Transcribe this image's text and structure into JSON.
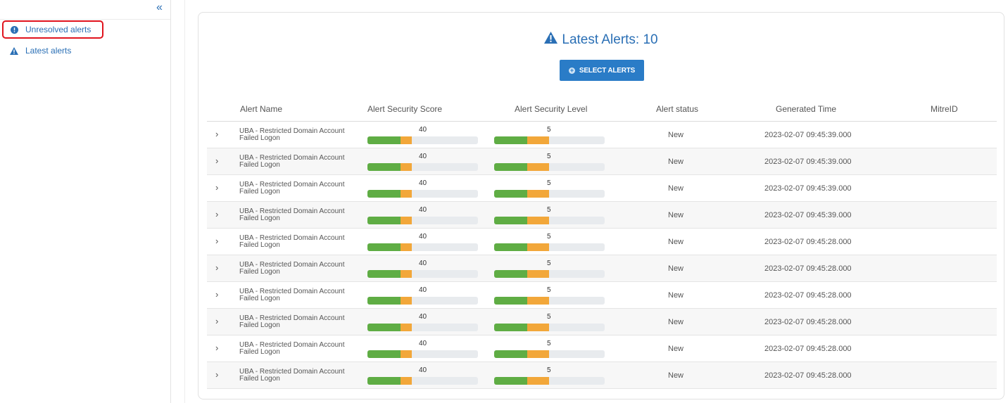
{
  "sidebar": {
    "collapse_glyph": "«",
    "items": [
      {
        "label": "Unresolved alerts",
        "icon": "info-circle-icon",
        "active": true
      },
      {
        "label": "Latest alerts",
        "icon": "warning-triangle-icon",
        "active": false
      }
    ]
  },
  "card": {
    "title": "Latest Alerts: 10",
    "select_button_label": "SELECT ALERTS"
  },
  "table": {
    "headers": [
      "Alert Name",
      "Alert Security Score",
      "Alert Security Level",
      "Alert status",
      "Generated Time",
      "MitreID"
    ],
    "rows": [
      {
        "name_line1": "UBA - Restricted Domain Account",
        "name_line2": "Failed Logon",
        "score": "40",
        "level": "5",
        "status": "New",
        "time": "2023-02-07 09:45:39.000",
        "mitre": ""
      },
      {
        "name_line1": "UBA - Restricted Domain Account",
        "name_line2": "Failed Logon",
        "score": "40",
        "level": "5",
        "status": "New",
        "time": "2023-02-07 09:45:39.000",
        "mitre": ""
      },
      {
        "name_line1": "UBA - Restricted Domain Account",
        "name_line2": "Failed Logon",
        "score": "40",
        "level": "5",
        "status": "New",
        "time": "2023-02-07 09:45:39.000",
        "mitre": ""
      },
      {
        "name_line1": "UBA - Restricted Domain Account",
        "name_line2": "Failed Logon",
        "score": "40",
        "level": "5",
        "status": "New",
        "time": "2023-02-07 09:45:39.000",
        "mitre": ""
      },
      {
        "name_line1": "UBA - Restricted Domain Account",
        "name_line2": "Failed Logon",
        "score": "40",
        "level": "5",
        "status": "New",
        "time": "2023-02-07 09:45:28.000",
        "mitre": ""
      },
      {
        "name_line1": "UBA - Restricted Domain Account",
        "name_line2": "Failed Logon",
        "score": "40",
        "level": "5",
        "status": "New",
        "time": "2023-02-07 09:45:28.000",
        "mitre": ""
      },
      {
        "name_line1": "UBA - Restricted Domain Account",
        "name_line2": "Failed Logon",
        "score": "40",
        "level": "5",
        "status": "New",
        "time": "2023-02-07 09:45:28.000",
        "mitre": ""
      },
      {
        "name_line1": "UBA - Restricted Domain Account",
        "name_line2": "Failed Logon",
        "score": "40",
        "level": "5",
        "status": "New",
        "time": "2023-02-07 09:45:28.000",
        "mitre": ""
      },
      {
        "name_line1": "UBA - Restricted Domain Account",
        "name_line2": "Failed Logon",
        "score": "40",
        "level": "5",
        "status": "New",
        "time": "2023-02-07 09:45:28.000",
        "mitre": ""
      },
      {
        "name_line1": "UBA - Restricted Domain Account",
        "name_line2": "Failed Logon",
        "score": "40",
        "level": "5",
        "status": "New",
        "time": "2023-02-07 09:45:28.000",
        "mitre": ""
      }
    ],
    "bar_fill": {
      "green_fraction": 0.3,
      "orange_fraction": 0.1
    }
  },
  "colors": {
    "accent": "#2a6fb5",
    "button": "#2a7cc7",
    "bar_green": "#5fad44",
    "bar_orange": "#f2a73a",
    "bar_track": "#e8ebee",
    "highlight": "#e0141e"
  }
}
